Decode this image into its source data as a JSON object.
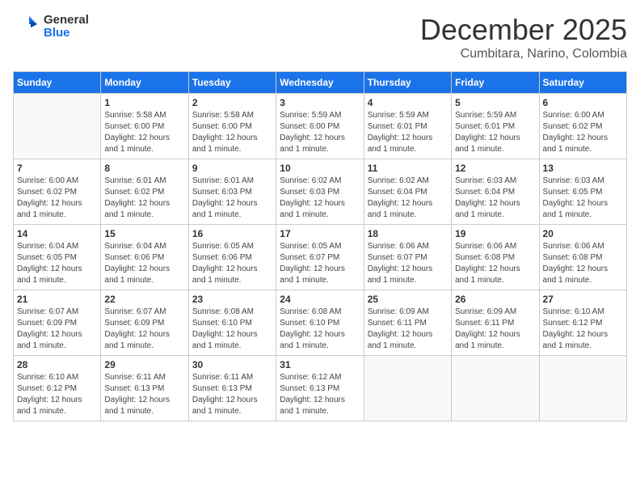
{
  "header": {
    "logo": {
      "general": "General",
      "blue": "Blue"
    },
    "title": "December 2025",
    "subtitle": "Cumbitara, Narino, Colombia"
  },
  "weekdays": [
    "Sunday",
    "Monday",
    "Tuesday",
    "Wednesday",
    "Thursday",
    "Friday",
    "Saturday"
  ],
  "weeks": [
    [
      null,
      {
        "day": 1,
        "sunrise": "5:58 AM",
        "sunset": "6:00 PM",
        "daylight": "12 hours and 1 minute."
      },
      {
        "day": 2,
        "sunrise": "5:58 AM",
        "sunset": "6:00 PM",
        "daylight": "12 hours and 1 minute."
      },
      {
        "day": 3,
        "sunrise": "5:59 AM",
        "sunset": "6:00 PM",
        "daylight": "12 hours and 1 minute."
      },
      {
        "day": 4,
        "sunrise": "5:59 AM",
        "sunset": "6:01 PM",
        "daylight": "12 hours and 1 minute."
      },
      {
        "day": 5,
        "sunrise": "5:59 AM",
        "sunset": "6:01 PM",
        "daylight": "12 hours and 1 minute."
      },
      {
        "day": 6,
        "sunrise": "6:00 AM",
        "sunset": "6:02 PM",
        "daylight": "12 hours and 1 minute."
      }
    ],
    [
      {
        "day": 7,
        "sunrise": "6:00 AM",
        "sunset": "6:02 PM",
        "daylight": "12 hours and 1 minute."
      },
      {
        "day": 8,
        "sunrise": "6:01 AM",
        "sunset": "6:02 PM",
        "daylight": "12 hours and 1 minute."
      },
      {
        "day": 9,
        "sunrise": "6:01 AM",
        "sunset": "6:03 PM",
        "daylight": "12 hours and 1 minute."
      },
      {
        "day": 10,
        "sunrise": "6:02 AM",
        "sunset": "6:03 PM",
        "daylight": "12 hours and 1 minute."
      },
      {
        "day": 11,
        "sunrise": "6:02 AM",
        "sunset": "6:04 PM",
        "daylight": "12 hours and 1 minute."
      },
      {
        "day": 12,
        "sunrise": "6:03 AM",
        "sunset": "6:04 PM",
        "daylight": "12 hours and 1 minute."
      },
      {
        "day": 13,
        "sunrise": "6:03 AM",
        "sunset": "6:05 PM",
        "daylight": "12 hours and 1 minute."
      }
    ],
    [
      {
        "day": 14,
        "sunrise": "6:04 AM",
        "sunset": "6:05 PM",
        "daylight": "12 hours and 1 minute."
      },
      {
        "day": 15,
        "sunrise": "6:04 AM",
        "sunset": "6:06 PM",
        "daylight": "12 hours and 1 minute."
      },
      {
        "day": 16,
        "sunrise": "6:05 AM",
        "sunset": "6:06 PM",
        "daylight": "12 hours and 1 minute."
      },
      {
        "day": 17,
        "sunrise": "6:05 AM",
        "sunset": "6:07 PM",
        "daylight": "12 hours and 1 minute."
      },
      {
        "day": 18,
        "sunrise": "6:06 AM",
        "sunset": "6:07 PM",
        "daylight": "12 hours and 1 minute."
      },
      {
        "day": 19,
        "sunrise": "6:06 AM",
        "sunset": "6:08 PM",
        "daylight": "12 hours and 1 minute."
      },
      {
        "day": 20,
        "sunrise": "6:06 AM",
        "sunset": "6:08 PM",
        "daylight": "12 hours and 1 minute."
      }
    ],
    [
      {
        "day": 21,
        "sunrise": "6:07 AM",
        "sunset": "6:09 PM",
        "daylight": "12 hours and 1 minute."
      },
      {
        "day": 22,
        "sunrise": "6:07 AM",
        "sunset": "6:09 PM",
        "daylight": "12 hours and 1 minute."
      },
      {
        "day": 23,
        "sunrise": "6:08 AM",
        "sunset": "6:10 PM",
        "daylight": "12 hours and 1 minute."
      },
      {
        "day": 24,
        "sunrise": "6:08 AM",
        "sunset": "6:10 PM",
        "daylight": "12 hours and 1 minute."
      },
      {
        "day": 25,
        "sunrise": "6:09 AM",
        "sunset": "6:11 PM",
        "daylight": "12 hours and 1 minute."
      },
      {
        "day": 26,
        "sunrise": "6:09 AM",
        "sunset": "6:11 PM",
        "daylight": "12 hours and 1 minute."
      },
      {
        "day": 27,
        "sunrise": "6:10 AM",
        "sunset": "6:12 PM",
        "daylight": "12 hours and 1 minute."
      }
    ],
    [
      {
        "day": 28,
        "sunrise": "6:10 AM",
        "sunset": "6:12 PM",
        "daylight": "12 hours and 1 minute."
      },
      {
        "day": 29,
        "sunrise": "6:11 AM",
        "sunset": "6:13 PM",
        "daylight": "12 hours and 1 minute."
      },
      {
        "day": 30,
        "sunrise": "6:11 AM",
        "sunset": "6:13 PM",
        "daylight": "12 hours and 1 minute."
      },
      {
        "day": 31,
        "sunrise": "6:12 AM",
        "sunset": "6:13 PM",
        "daylight": "12 hours and 1 minute."
      },
      null,
      null,
      null
    ]
  ]
}
